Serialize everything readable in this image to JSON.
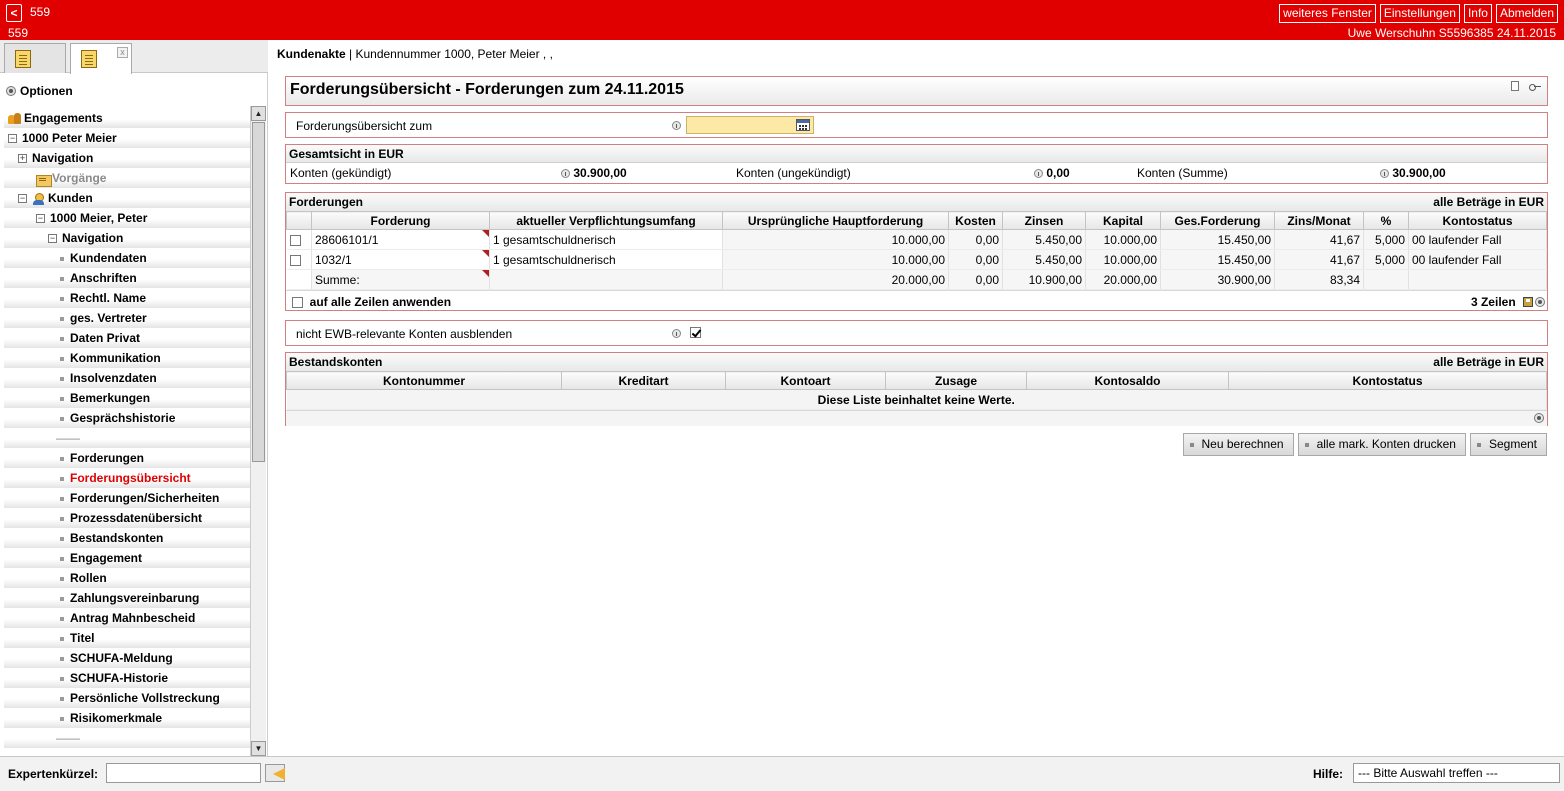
{
  "topbar": {
    "back_symbol": "<",
    "num1": "559",
    "num2": "559",
    "user_line": "Uwe Werschuhn S5596385    24.11.2015",
    "buttons": [
      "weiteres Fenster",
      "Einstellungen",
      "Info",
      "Abmelden"
    ]
  },
  "sidebar": {
    "close_symbol": "x",
    "optionen": "Optionen",
    "tree": [
      {
        "label": "Engagements",
        "level": 0,
        "type": "people"
      },
      {
        "label": "1000 Peter Meier",
        "level": 0,
        "type": "minus"
      },
      {
        "label": "Navigation",
        "level": 1,
        "type": "plus"
      },
      {
        "label": "Vorgänge",
        "level": 2,
        "type": "folder",
        "gray": true
      },
      {
        "label": "Kunden",
        "level": 1,
        "type": "minus-person"
      },
      {
        "label": "1000 Meier, Peter",
        "level": 2,
        "type": "minus"
      },
      {
        "label": "Navigation",
        "level": 3,
        "type": "minus"
      },
      {
        "label": "Kundendaten",
        "level": 4,
        "type": "bullet"
      },
      {
        "label": "Anschriften",
        "level": 4,
        "type": "bullet"
      },
      {
        "label": "Rechtl. Name",
        "level": 4,
        "type": "bullet"
      },
      {
        "label": "ges. Vertreter",
        "level": 4,
        "type": "bullet"
      },
      {
        "label": "Daten Privat",
        "level": 4,
        "type": "bullet"
      },
      {
        "label": "Kommunikation",
        "level": 4,
        "type": "bullet"
      },
      {
        "label": "Insolvenzdaten",
        "level": 4,
        "type": "bullet"
      },
      {
        "label": "Bemerkungen",
        "level": 4,
        "type": "bullet"
      },
      {
        "label": "Gesprächshistorie",
        "level": 4,
        "type": "bullet"
      },
      {
        "label": "——",
        "level": 4,
        "type": "sep"
      },
      {
        "label": "Forderungen",
        "level": 4,
        "type": "bullet"
      },
      {
        "label": "Forderungsübersicht",
        "level": 4,
        "type": "bullet",
        "active": true
      },
      {
        "label": "Forderungen/Sicherheiten",
        "level": 4,
        "type": "bullet"
      },
      {
        "label": "Prozessdatenübersicht",
        "level": 4,
        "type": "bullet"
      },
      {
        "label": "Bestandskonten",
        "level": 4,
        "type": "bullet"
      },
      {
        "label": "Engagement",
        "level": 4,
        "type": "bullet"
      },
      {
        "label": "Rollen",
        "level": 4,
        "type": "bullet"
      },
      {
        "label": "Zahlungsvereinbarung",
        "level": 4,
        "type": "bullet"
      },
      {
        "label": "Antrag Mahnbescheid",
        "level": 4,
        "type": "bullet"
      },
      {
        "label": "Titel",
        "level": 4,
        "type": "bullet"
      },
      {
        "label": "SCHUFA-Meldung",
        "level": 4,
        "type": "bullet"
      },
      {
        "label": "SCHUFA-Historie",
        "level": 4,
        "type": "bullet"
      },
      {
        "label": "Persönliche Vollstreckung",
        "level": 4,
        "type": "bullet"
      },
      {
        "label": "Risikomerkmale",
        "level": 4,
        "type": "bullet"
      },
      {
        "label": "——",
        "level": 4,
        "type": "sep"
      }
    ],
    "scroll_up_symbol": "▲",
    "scroll_down_symbol": "▼"
  },
  "bottombar": {
    "expert_label": "Expertenkürzel:",
    "expert_value": "",
    "help_label": "Hilfe:",
    "help_select": "--- Bitte Auswahl treffen ---"
  },
  "main": {
    "crumb_bold": "Kundenakte",
    "crumb_rest": " | Kundennummer 1000, Peter Meier , ,",
    "title": "Forderungsübersicht - Forderungen zum 24.11.2015",
    "date_label": "Forderungsübersicht zum",
    "date_value": "",
    "gesamt": {
      "title": "Gesamtsicht in  EUR",
      "items": [
        {
          "label": "Konten (gekündigt)",
          "value": "30.900,00"
        },
        {
          "label": "Konten (ungekündigt)",
          "value": "0,00"
        },
        {
          "label": "Konten (Summe)",
          "value": "30.900,00"
        }
      ]
    },
    "forderungen": {
      "title": "Forderungen",
      "right": "alle Beträge in EUR",
      "headers": [
        "Forderung",
        "aktueller Verpflichtungsumfang",
        "Ursprüngliche Hauptforderung",
        "Kosten",
        "Zinsen",
        "Kapital",
        "Ges.Forderung",
        "Zins/Monat",
        "%",
        "Kontostatus"
      ],
      "rows": [
        [
          "28606101/1",
          "1 gesamtschuldnerisch",
          "10.000,00",
          "0,00",
          "5.450,00",
          "10.000,00",
          "15.450,00",
          "41,67",
          "5,000",
          "00 laufender Fall"
        ],
        [
          "1032/1",
          "1 gesamtschuldnerisch",
          "10.000,00",
          "0,00",
          "5.450,00",
          "10.000,00",
          "15.450,00",
          "41,67",
          "5,000",
          "00 laufender Fall"
        ]
      ],
      "sum_row": [
        "Summe:",
        "",
        "20.000,00",
        "0,00",
        "10.900,00",
        "20.000,00",
        "30.900,00",
        "83,34",
        "",
        ""
      ],
      "apply_all": "auf alle Zeilen anwenden",
      "row_count": "3 Zeilen"
    },
    "ewb_label": "nicht EWB-relevante Konten ausblenden",
    "ewb_checked": true,
    "bestand": {
      "title": "Bestandskonten",
      "right": "alle Beträge in EUR",
      "headers": [
        "Kontonummer",
        "Kreditart",
        "Kontoart",
        "Zusage",
        "Kontosaldo",
        "Kontostatus"
      ],
      "empty": "Diese Liste beinhaltet keine Werte."
    },
    "buttons": [
      "Neu berechnen",
      "alle mark. Konten drucken",
      "Segment"
    ]
  }
}
